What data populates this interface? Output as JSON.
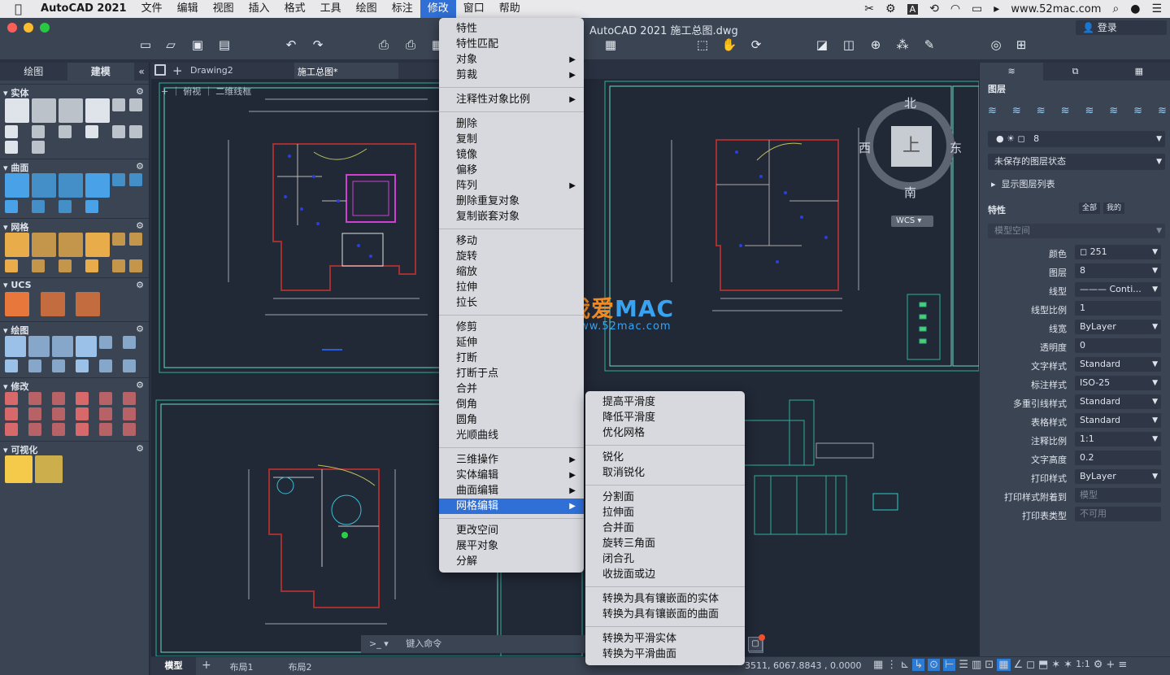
{
  "menubar": {
    "apple": "",
    "app": "AutoCAD 2021",
    "items": [
      "文件",
      "编辑",
      "视图",
      "插入",
      "格式",
      "工具",
      "绘图",
      "标注",
      "修改",
      "窗口",
      "帮助"
    ],
    "active_index": 8,
    "right": {
      "site": "www.52mac.com"
    }
  },
  "window": {
    "title": "AutoCAD 2021    施工总图.dwg",
    "login": "登录"
  },
  "left_palette": {
    "tabs": [
      "绘图",
      "建模"
    ],
    "active_tab": 1,
    "sections": [
      {
        "title": "实体"
      },
      {
        "title": "曲面"
      },
      {
        "title": "网格"
      },
      {
        "title": "UCS"
      },
      {
        "title": "绘图"
      },
      {
        "title": "修改"
      },
      {
        "title": "可视化"
      }
    ]
  },
  "file_tabs": [
    "Drawing2",
    "施工总图*"
  ],
  "viewport": {
    "label_plus": "+",
    "view": "俯视",
    "style": "二维线框"
  },
  "viewcube": {
    "north": "北",
    "south": "南",
    "east": "东",
    "west": "西",
    "top": "上",
    "wcs": "WCS"
  },
  "watermark": {
    "cn": "我爱",
    "mac": "MAC",
    "url": "www.52mac.com"
  },
  "modify_menu": {
    "groups": [
      [
        {
          "label": "特性"
        },
        {
          "label": "特性匹配"
        },
        {
          "label": "对象",
          "sub": true
        },
        {
          "label": "剪裁",
          "sub": true
        }
      ],
      [
        {
          "label": "注释性对象比例",
          "sub": true
        }
      ],
      [
        {
          "label": "删除"
        },
        {
          "label": "复制"
        },
        {
          "label": "镜像"
        },
        {
          "label": "偏移"
        },
        {
          "label": "阵列",
          "sub": true
        },
        {
          "label": "删除重复对象"
        },
        {
          "label": "复制嵌套对象"
        }
      ],
      [
        {
          "label": "移动"
        },
        {
          "label": "旋转"
        },
        {
          "label": "缩放"
        },
        {
          "label": "拉伸"
        },
        {
          "label": "拉长"
        }
      ],
      [
        {
          "label": "修剪"
        },
        {
          "label": "延伸"
        },
        {
          "label": "打断"
        },
        {
          "label": "打断于点"
        },
        {
          "label": "合并"
        },
        {
          "label": "倒角"
        },
        {
          "label": "圆角"
        },
        {
          "label": "光顺曲线"
        }
      ],
      [
        {
          "label": "三维操作",
          "sub": true
        },
        {
          "label": "实体编辑",
          "sub": true
        },
        {
          "label": "曲面编辑",
          "sub": true
        },
        {
          "label": "网格编辑",
          "sub": true,
          "highlight": true
        }
      ],
      [
        {
          "label": "更改空间"
        },
        {
          "label": "展平对象"
        },
        {
          "label": "分解"
        }
      ]
    ]
  },
  "mesh_submenu": {
    "groups": [
      [
        {
          "label": "提高平滑度"
        },
        {
          "label": "降低平滑度"
        },
        {
          "label": "优化网格"
        }
      ],
      [
        {
          "label": "锐化"
        },
        {
          "label": "取消锐化"
        }
      ],
      [
        {
          "label": "分割面"
        },
        {
          "label": "拉伸面"
        },
        {
          "label": "合并面"
        },
        {
          "label": "旋转三角面"
        },
        {
          "label": "闭合孔"
        },
        {
          "label": "收拢面或边"
        }
      ],
      [
        {
          "label": "转换为具有镶嵌面的实体"
        },
        {
          "label": "转换为具有镶嵌面的曲面"
        }
      ],
      [
        {
          "label": "转换为平滑实体"
        },
        {
          "label": "转换为平滑曲面"
        }
      ]
    ]
  },
  "right_palette": {
    "layers_title": "图层",
    "layer_value": "8",
    "layer_state": "未保存的图层状态",
    "show_layer_list": "显示图层列表",
    "props_title": "特性",
    "props_tabs": [
      "全部",
      "我的"
    ],
    "space": "模型空间",
    "props": [
      {
        "label": "颜色",
        "value": "251",
        "dd": true,
        "swatch": true
      },
      {
        "label": "图层",
        "value": "8",
        "dd": true
      },
      {
        "label": "线型",
        "value": "——— Conti...",
        "dd": true
      },
      {
        "label": "线型比例",
        "value": "1"
      },
      {
        "label": "线宽",
        "value": "ByLayer",
        "dd": true
      },
      {
        "label": "透明度",
        "value": "0"
      },
      {
        "label": "文字样式",
        "value": "Standard",
        "dd": true
      },
      {
        "label": "标注样式",
        "value": "ISO-25",
        "dd": true
      },
      {
        "label": "多重引线样式",
        "value": "Standard",
        "dd": true
      },
      {
        "label": "表格样式",
        "value": "Standard",
        "dd": true
      },
      {
        "label": "注释比例",
        "value": "1:1",
        "dd": true
      },
      {
        "label": "文字高度",
        "value": "0.2"
      },
      {
        "label": "打印样式",
        "value": "ByLayer",
        "dd": true
      },
      {
        "label": "打印样式附着到",
        "value": "模型",
        "disabled": true
      },
      {
        "label": "打印表类型",
        "value": "不可用",
        "disabled": true
      }
    ]
  },
  "command": {
    "prompt": ">_ ▾",
    "placeholder": "键入命令"
  },
  "status": {
    "tabs": [
      "模型",
      "布局1",
      "布局2"
    ],
    "coords": "3511,   6067.8843  , 0.0000",
    "scale": "1:1"
  }
}
